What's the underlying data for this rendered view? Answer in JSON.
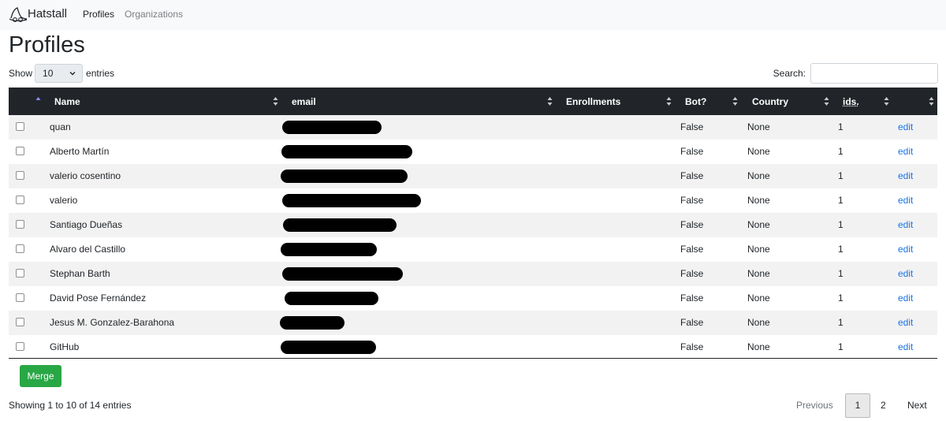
{
  "navbar": {
    "brand": "Hatstall",
    "links": [
      "Profiles",
      "Organizations"
    ]
  },
  "page_title": "Profiles",
  "length_control": {
    "show_label": "Show",
    "selected": "10",
    "entries_label": "entries"
  },
  "search": {
    "label": "Search:",
    "value": "",
    "placeholder": ""
  },
  "table": {
    "columns": [
      "Name",
      "email",
      "Enrollments",
      "Bot?",
      "Country",
      "ids.",
      ""
    ],
    "rows": [
      {
        "name": "quan",
        "bot": "False",
        "country": "None",
        "ids": "1",
        "action": "edit"
      },
      {
        "name": "Alberto Martín",
        "bot": "False",
        "country": "None",
        "ids": "1",
        "action": "edit"
      },
      {
        "name": "valerio cosentino",
        "bot": "False",
        "country": "None",
        "ids": "1",
        "action": "edit"
      },
      {
        "name": "valerio",
        "bot": "False",
        "country": "None",
        "ids": "1",
        "action": "edit"
      },
      {
        "name": "Santiago Dueñas",
        "bot": "False",
        "country": "None",
        "ids": "1",
        "action": "edit"
      },
      {
        "name": "Alvaro del Castillo",
        "bot": "False",
        "country": "None",
        "ids": "1",
        "action": "edit"
      },
      {
        "name": "Stephan Barth",
        "bot": "False",
        "country": "None",
        "ids": "1",
        "action": "edit"
      },
      {
        "name": "David Pose Fernández",
        "bot": "False",
        "country": "None",
        "ids": "1",
        "action": "edit"
      },
      {
        "name": "Jesus M. Gonzalez-Barahona",
        "bot": "False",
        "country": "None",
        "ids": "1",
        "action": "edit"
      },
      {
        "name": "GitHub",
        "bot": "False",
        "country": "None",
        "ids": "1",
        "action": "edit"
      }
    ]
  },
  "merge_button": "Merge",
  "info_text": "Showing 1 to 10 of 14 entries",
  "pagination": {
    "previous": "Previous",
    "pages": [
      "1",
      "2"
    ],
    "current": "1",
    "next": "Next"
  },
  "colors": {
    "header_bg": "#212529",
    "link": "#1a73e8",
    "merge": "#28a745",
    "row_stripe": "#f2f2f2"
  },
  "icons": {
    "brand": "hat-icon",
    "sort": "sort-arrows-icon",
    "select": "chevron-down-icon"
  }
}
